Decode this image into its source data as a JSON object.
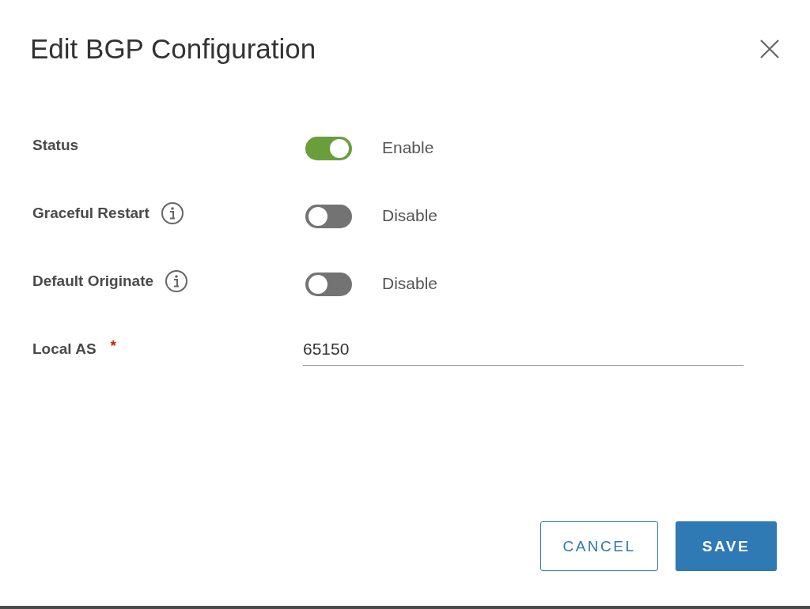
{
  "dialog": {
    "title": "Edit BGP Configuration"
  },
  "fields": [
    {
      "kind": "toggle",
      "label": "Status",
      "info": false,
      "on": true,
      "state_text": "Enable"
    },
    {
      "kind": "toggle",
      "label": "Graceful Restart",
      "info": true,
      "on": false,
      "state_text": "Disable"
    },
    {
      "kind": "toggle",
      "label": "Default Originate",
      "info": true,
      "on": false,
      "state_text": "Disable"
    },
    {
      "kind": "text",
      "label": "Local AS",
      "required_mark": "*",
      "value": "65150"
    }
  ],
  "buttons": [
    {
      "label": "CANCEL",
      "kind": "secondary"
    },
    {
      "label": "SAVE",
      "kind": "primary"
    }
  ]
}
